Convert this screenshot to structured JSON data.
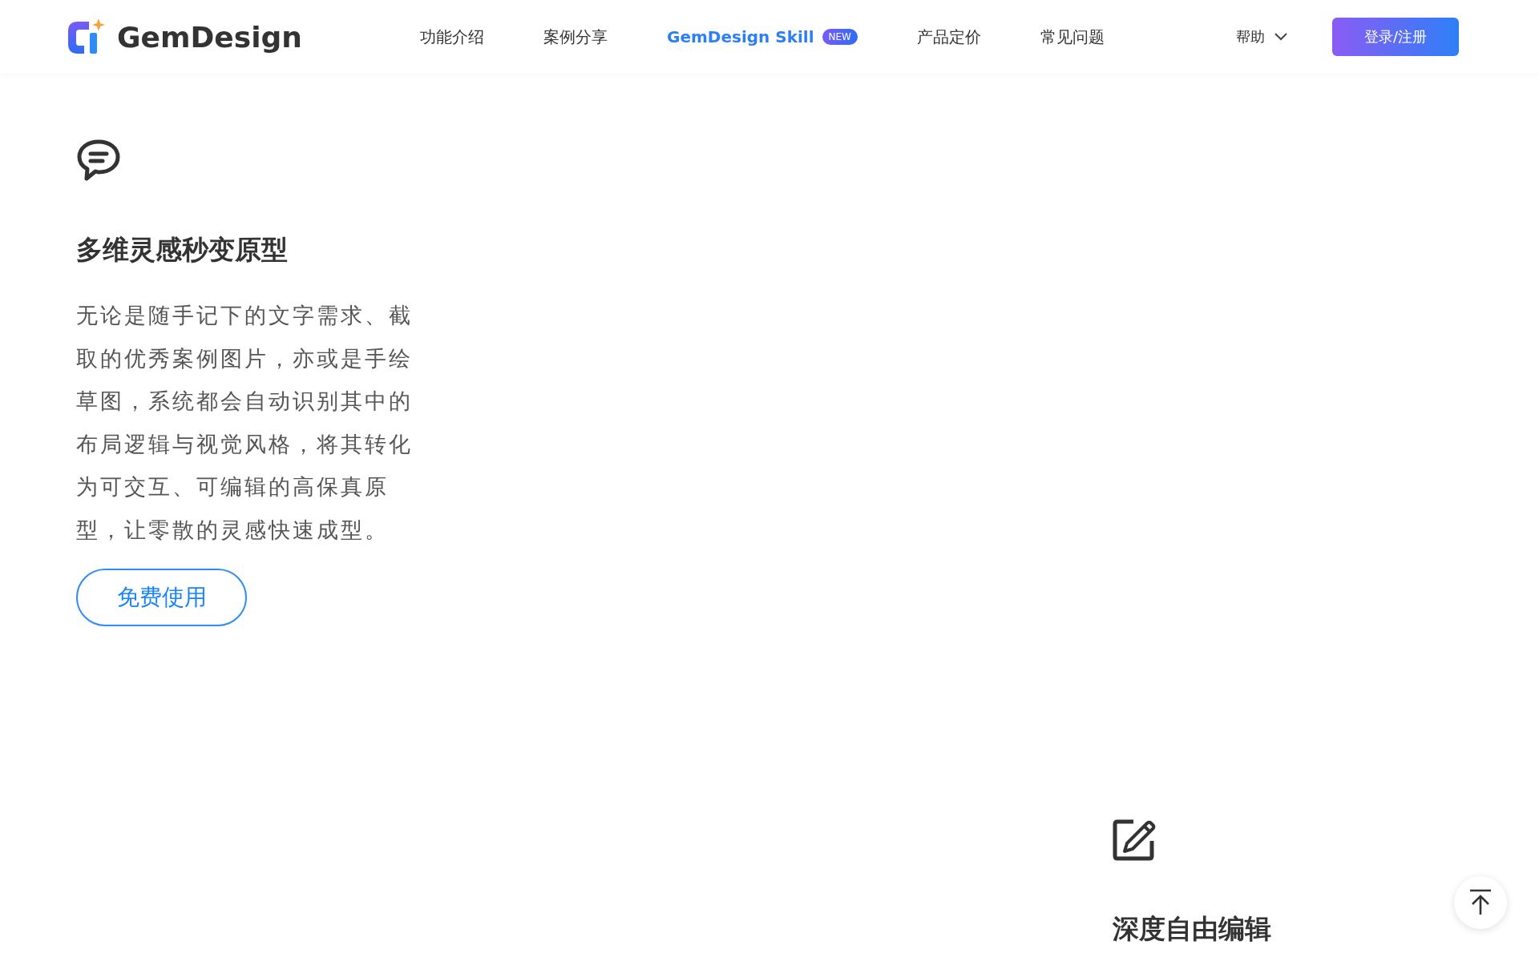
{
  "header": {
    "logo_text": "GemDesign",
    "nav": [
      {
        "label": "功能介绍",
        "selected": false
      },
      {
        "label": "案例分享",
        "selected": false
      },
      {
        "label": "GemDesign Skill",
        "selected": true,
        "badge": "NEW"
      },
      {
        "label": "产品定价",
        "selected": false
      },
      {
        "label": "常见问题",
        "selected": false
      }
    ],
    "help": "帮助",
    "login_button": "登录/注册"
  },
  "features": [
    {
      "title": "多维灵感秒变原型",
      "description": "无论是随手记下的文字需求、截取的优秀案例图片，亦或是手绘草图，系统都会自动识别其中的布局逻辑与视觉风格，将其转化为可交互、可编辑的高保真原型，让零散的灵感快速成型。",
      "button": "免费使用"
    },
    {
      "title": "深度自由编辑"
    }
  ]
}
